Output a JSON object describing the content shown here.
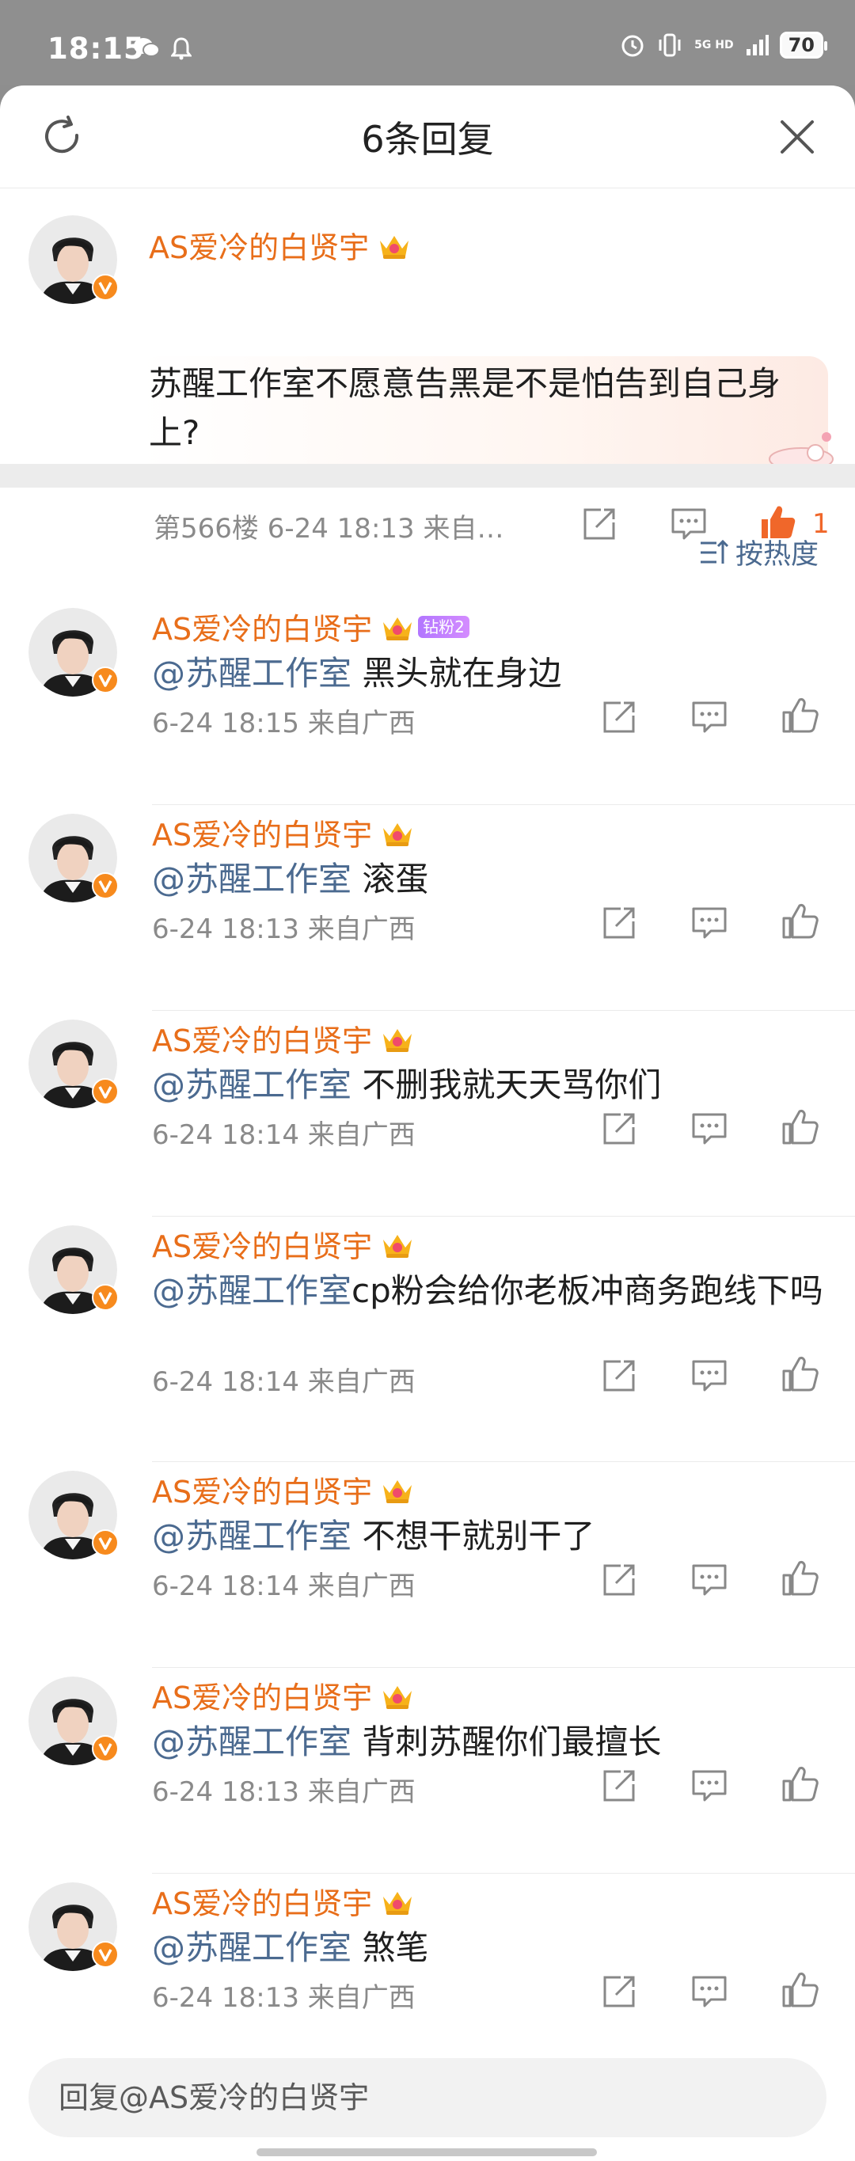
{
  "status_bar": {
    "time": "18:15",
    "network": "5G HD",
    "battery": "70",
    "icons": [
      "wechat-icon",
      "bell-icon",
      "alarm-icon",
      "vibrate-icon",
      "signal-icon"
    ]
  },
  "header": {
    "title": "6条回复",
    "refresh_icon": "refresh-icon",
    "close_icon": "close-icon"
  },
  "root_comment": {
    "username": "AS爱冷的白贤宇",
    "text": "苏醒工作室不愿意告黑是不是怕告到自己身上?",
    "meta": "第566楼  6-24 18:13  来自…",
    "like_count": "1",
    "liked": true
  },
  "sort": {
    "label": "按热度",
    "icon": "sort-icon"
  },
  "replies": [
    {
      "username": "AS爱冷的白贤宇",
      "badge": "钻粉2",
      "mention": "@苏醒工作室",
      "text": " 黑头就在身边",
      "meta": "6-24 18:15  来自广西"
    },
    {
      "username": "AS爱冷的白贤宇",
      "badge": "",
      "mention": "@苏醒工作室",
      "text": " 滚蛋",
      "meta": "6-24 18:13  来自广西"
    },
    {
      "username": "AS爱冷的白贤宇",
      "badge": "",
      "mention": "@苏醒工作室",
      "text": " 不删我就天天骂你们",
      "meta": "6-24 18:14  来自广西"
    },
    {
      "username": "AS爱冷的白贤宇",
      "badge": "",
      "mention": "@苏醒工作室",
      "text": "cp粉会给你老板冲商务跑线下吗",
      "meta": "6-24 18:14  来自广西"
    },
    {
      "username": "AS爱冷的白贤宇",
      "badge": "",
      "mention": "@苏醒工作室",
      "text": " 不想干就别干了",
      "meta": "6-24 18:14  来自广西"
    },
    {
      "username": "AS爱冷的白贤宇",
      "badge": "",
      "mention": "@苏醒工作室",
      "text": " 背刺苏醒你们最擅长",
      "meta": "6-24 18:13  来自广西"
    },
    {
      "username": "AS爱冷的白贤宇",
      "badge": "",
      "mention": "@苏醒工作室",
      "text": " 煞笔",
      "meta": "6-24 18:13  来自广西"
    }
  ],
  "input": {
    "placeholder": "回复@AS爱冷的白贤宇"
  },
  "colors": {
    "username": "#e86e1a",
    "mention": "#4b6a90",
    "meta": "#8a8a8a",
    "like_active": "#f0672a"
  }
}
